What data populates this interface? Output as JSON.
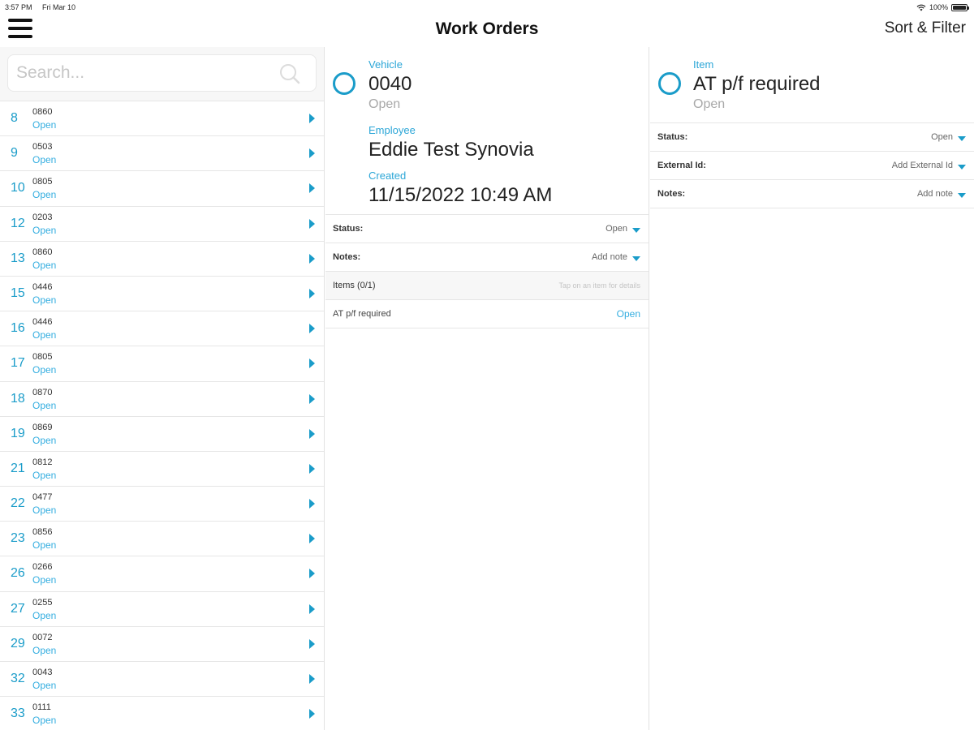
{
  "status_bar": {
    "time": "3:57 PM",
    "date": "Fri Mar 10",
    "battery": "100%"
  },
  "header": {
    "title": "Work Orders",
    "sort_filter_label": "Sort & Filter"
  },
  "search": {
    "placeholder": "Search..."
  },
  "work_orders": [
    {
      "number": "8",
      "vehicle": "0860",
      "status": "Open"
    },
    {
      "number": "9",
      "vehicle": "0503",
      "status": "Open"
    },
    {
      "number": "10",
      "vehicle": "0805",
      "status": "Open"
    },
    {
      "number": "12",
      "vehicle": "0203",
      "status": "Open"
    },
    {
      "number": "13",
      "vehicle": "0860",
      "status": "Open"
    },
    {
      "number": "15",
      "vehicle": "0446",
      "status": "Open"
    },
    {
      "number": "16",
      "vehicle": "0446",
      "status": "Open"
    },
    {
      "number": "17",
      "vehicle": "0805",
      "status": "Open"
    },
    {
      "number": "18",
      "vehicle": "0870",
      "status": "Open"
    },
    {
      "number": "19",
      "vehicle": "0869",
      "status": "Open"
    },
    {
      "number": "21",
      "vehicle": "0812",
      "status": "Open"
    },
    {
      "number": "22",
      "vehicle": "0477",
      "status": "Open"
    },
    {
      "number": "23",
      "vehicle": "0856",
      "status": "Open"
    },
    {
      "number": "26",
      "vehicle": "0266",
      "status": "Open"
    },
    {
      "number": "27",
      "vehicle": "0255",
      "status": "Open"
    },
    {
      "number": "29",
      "vehicle": "0072",
      "status": "Open"
    },
    {
      "number": "32",
      "vehicle": "0043",
      "status": "Open"
    },
    {
      "number": "33",
      "vehicle": "0111",
      "status": "Open"
    }
  ],
  "work_order_detail": {
    "vehicle_label": "Vehicle",
    "vehicle": "0040",
    "vehicle_status": "Open",
    "employee_label": "Employee",
    "employee": "Eddie Test Synovia",
    "created_label": "Created",
    "created": "11/15/2022 10:49 AM",
    "status_label": "Status:",
    "status_value": "Open",
    "notes_label": "Notes:",
    "notes_value": "Add note",
    "items_header": "Items (0/1)",
    "items_hint": "Tap on an item for details",
    "items": [
      {
        "name": "AT p/f required",
        "status": "Open"
      }
    ]
  },
  "item_detail": {
    "item_label": "Item",
    "item_name": "AT p/f required",
    "item_status": "Open",
    "status_label": "Status:",
    "status_value": "Open",
    "external_id_label": "External Id:",
    "external_id_value": "Add External Id",
    "notes_label": "Notes:",
    "notes_value": "Add note"
  },
  "colors": {
    "accent": "#1a9cc9",
    "accent_light": "#35aee0",
    "muted_text": "#a8a8a8"
  }
}
